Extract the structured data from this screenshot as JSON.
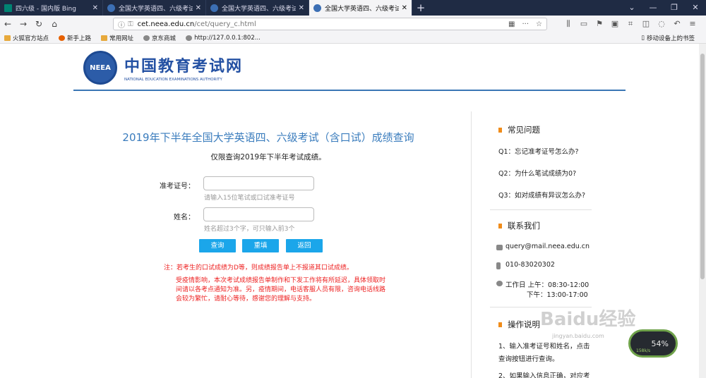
{
  "browser": {
    "tabs": [
      {
        "title": "四六级 - 国内版 Bing",
        "active": false,
        "favicon": "bing-icon"
      },
      {
        "title": "全国大学英语四、六级考试(CET",
        "active": false,
        "favicon": "neea-icon"
      },
      {
        "title": "全国大学英语四、六级考试成绩",
        "active": false,
        "favicon": "neea-icon"
      },
      {
        "title": "全国大学英语四、六级考试成绩",
        "active": true,
        "favicon": "neea-icon"
      }
    ],
    "new_tab": "+",
    "url_host": "cet.neea.edu.cn",
    "url_path": "/cet/query_c.html",
    "bookmarks": [
      "火狐官方站点",
      "新手上路",
      "常用网址",
      "京东商城",
      "http://127.0.0.1:802..."
    ],
    "mobile_bookmarks": "移动设备上的书签"
  },
  "header": {
    "logo_cn": "中国教育考试网",
    "logo_en": "NATIONAL EDUCATION EXAMINATIONS AUTHORITY",
    "seal_text": "NEEA"
  },
  "form": {
    "title": "2019年下半年全国大学英语四、六级考试（含口试）成绩查询",
    "subtitle": "仅限查询2019年下半年考试成绩。",
    "ticket_label": "准考证号：",
    "ticket_hint": "请输入15位笔试或口试准考证号",
    "name_label": "姓名：",
    "name_hint": "姓名超过3个字，可只输入前3个",
    "btn_query": "查询",
    "btn_reset": "重填",
    "btn_back": "返回",
    "note": "注：若考生的口试成绩为D等，则成绩报告单上不报道其口试成绩。",
    "notice": "受疫情影响，本次考试成绩报告单制作和下发工作将有所延迟，具体领取时间请以各考点通知为准。另，疫情期间，电话客服人员有限，咨询电话线路会较为繁忙，请耐心等待，感谢您的理解与支持。"
  },
  "sidebar": {
    "faq_title": "常见问题",
    "faq": [
      "Q1：忘记准考证号怎么办?",
      "Q2：为什么笔试成绩为0?",
      "Q3：如对成绩有异议怎么办?"
    ],
    "contact_title": "联系我们",
    "email": "query@mail.neea.edu.cn",
    "phone": "010-83020302",
    "hours_am": "工作日 上午：08:30-12:00",
    "hours_pm": "下午：13:00-17:00",
    "ops_title": "操作说明",
    "ops": [
      "1、输入准考证号和姓名，点击",
      "查询按钮进行查询。",
      "2、如果输入信息正确，对应考"
    ]
  },
  "overlay": {
    "watermark": "Baidu经验",
    "watermark_url": "jingyan.baidu.com",
    "speed_percent": "54%",
    "speed_rate": "158k/s"
  },
  "colors": {
    "accent": "#3a7cbd",
    "button": "#1ba6ea",
    "warning": "#e22222",
    "bullet": "#f08c1a"
  }
}
